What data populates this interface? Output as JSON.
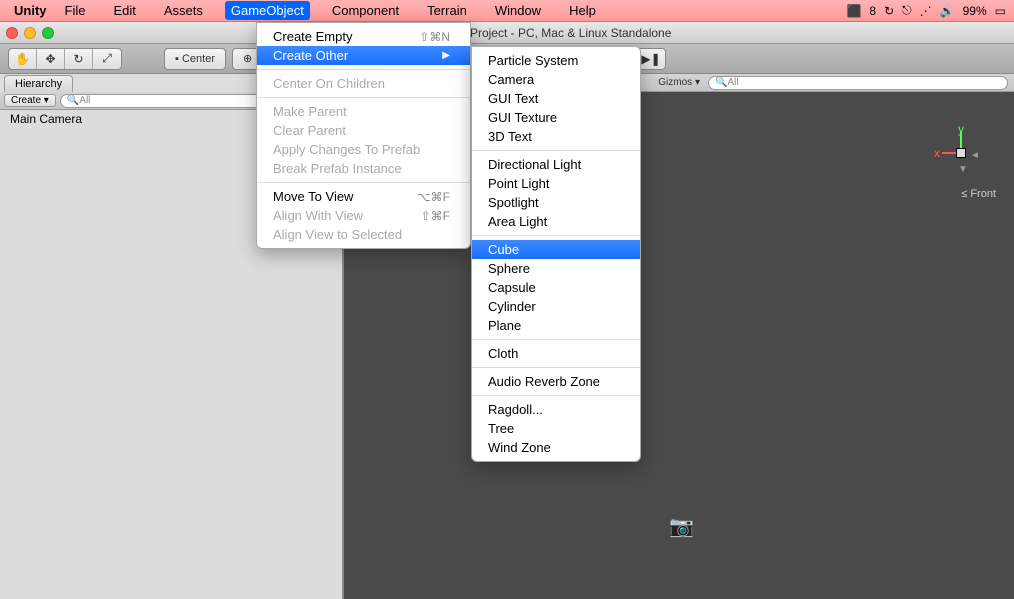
{
  "menubar": {
    "appname": "Unity",
    "items": [
      "File",
      "Edit",
      "Assets",
      "GameObject",
      "Component",
      "Terrain",
      "Window",
      "Help"
    ],
    "active_index": 3,
    "status": {
      "adobe": "8",
      "battery": "99%"
    }
  },
  "window": {
    "title": "Untitled - New Unity Project - PC, Mac & Linux Standalone"
  },
  "toolbar": {
    "pivot_label": "Center"
  },
  "hierarchy": {
    "tab": "Hierarchy",
    "create_label": "Create",
    "search_placeholder": "All",
    "items": [
      "Main Camera"
    ]
  },
  "scene": {
    "gizmos_label": "Gizmos",
    "search_placeholder": "All",
    "front_label": "Front",
    "axis_x": "x",
    "axis_y": "y",
    "persp_arrow": "≤"
  },
  "gameobject_menu": {
    "items": [
      {
        "label": "Create Empty",
        "shortcut": "⇧⌘N"
      },
      {
        "label": "Create Other",
        "submenu": true,
        "highlighted": true
      },
      {
        "sep": true
      },
      {
        "label": "Center On Children",
        "disabled": true
      },
      {
        "sep": true
      },
      {
        "label": "Make Parent",
        "disabled": true
      },
      {
        "label": "Clear Parent",
        "disabled": true
      },
      {
        "label": "Apply Changes To Prefab",
        "disabled": true
      },
      {
        "label": "Break Prefab Instance",
        "disabled": true
      },
      {
        "sep": true
      },
      {
        "label": "Move To View",
        "shortcut": "⌥⌘F"
      },
      {
        "label": "Align With View",
        "shortcut": "⇧⌘F",
        "disabled": true
      },
      {
        "label": "Align View to Selected",
        "disabled": true
      }
    ]
  },
  "create_other_menu": {
    "items": [
      {
        "label": "Particle System"
      },
      {
        "label": "Camera"
      },
      {
        "label": "GUI Text"
      },
      {
        "label": "GUI Texture"
      },
      {
        "label": "3D Text"
      },
      {
        "sep": true
      },
      {
        "label": "Directional Light"
      },
      {
        "label": "Point Light"
      },
      {
        "label": "Spotlight"
      },
      {
        "label": "Area Light"
      },
      {
        "sep": true
      },
      {
        "label": "Cube",
        "highlighted": true
      },
      {
        "label": "Sphere"
      },
      {
        "label": "Capsule"
      },
      {
        "label": "Cylinder"
      },
      {
        "label": "Plane"
      },
      {
        "sep": true
      },
      {
        "label": "Cloth"
      },
      {
        "sep": true
      },
      {
        "label": "Audio Reverb Zone"
      },
      {
        "sep": true
      },
      {
        "label": "Ragdoll..."
      },
      {
        "label": "Tree"
      },
      {
        "label": "Wind Zone"
      }
    ]
  }
}
